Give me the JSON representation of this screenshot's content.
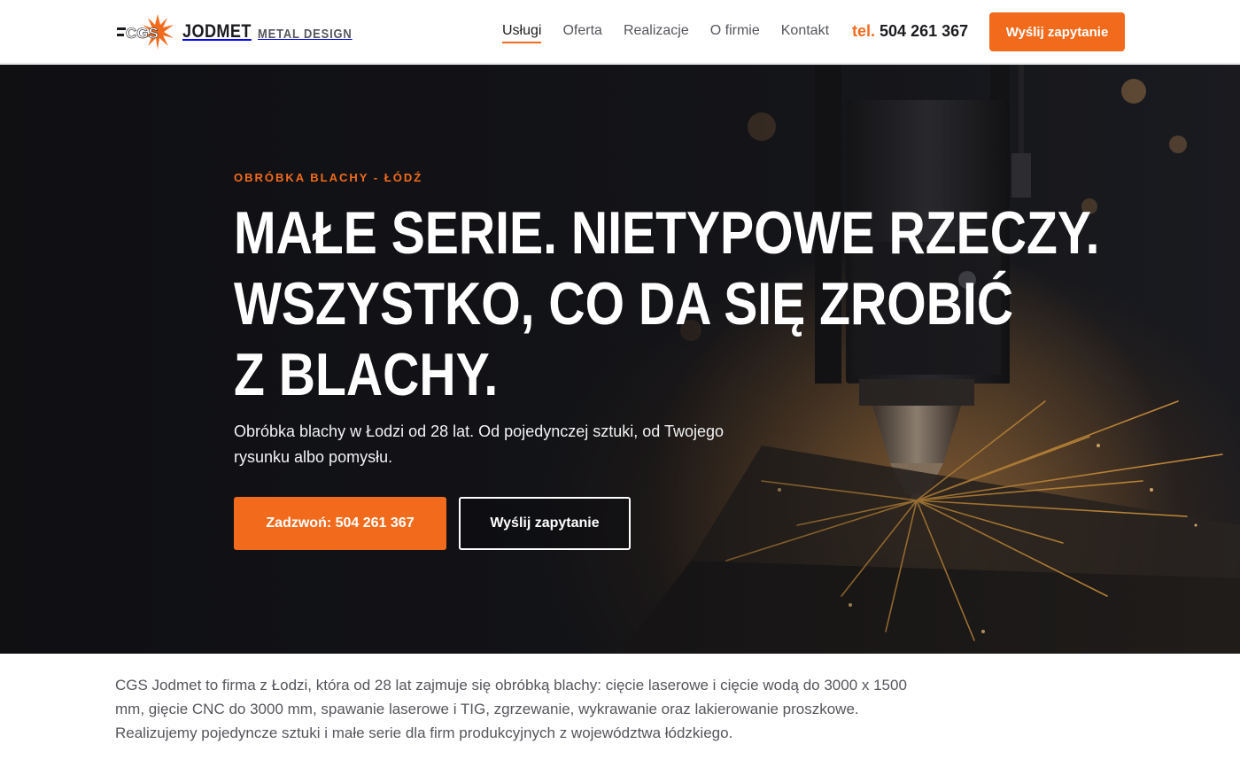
{
  "brand": {
    "mark_text": "CGS",
    "name": "JODMET",
    "tagline": "METAL DESIGN"
  },
  "nav": {
    "items": [
      {
        "label": "Usługi",
        "active": true
      },
      {
        "label": "Oferta",
        "active": false
      },
      {
        "label": "Realizacje",
        "active": false
      },
      {
        "label": "O firmie",
        "active": false
      },
      {
        "label": "Kontakt",
        "active": false
      }
    ]
  },
  "header": {
    "phone_prefix": "tel.",
    "phone_number": "504 261 367",
    "cta_label": "Wyślij zapytanie"
  },
  "hero": {
    "eyebrow": "OBRÓBKA BLACHY - ŁÓDŹ",
    "headline_lines": [
      "MAŁE SERIE. NIETYPOWE RZECZY.",
      "WSZYSTKO, CO DA SIĘ ZROBIĆ",
      "Z BLACHY."
    ],
    "lead": "Obróbka blachy w Łodzi od 28 lat. Od pojedynczej sztuki, od Twojego rysunku albo pomysłu.",
    "primary_cta": "Zadzwoń: 504 261 367",
    "secondary_cta": "Wyślij zapytanie"
  },
  "intro": {
    "text": "CGS Jodmet to firma z Łodzi, która od 28 lat zajmuje się obróbką blachy: cięcie laserowe i cięcie wodą do 3000 x 1500 mm, gięcie CNC do 3000 mm, spawanie laserowe i TIG, zgrzewanie, wykrawanie oraz lakierowanie proszkowe. Realizujemy pojedyncze sztuki i małe serie dla firm produkcyjnych z województwa łódzkiego."
  },
  "colors": {
    "accent": "#f26b1d",
    "text_dark": "#1b1b1f",
    "text_muted": "#55565c"
  }
}
